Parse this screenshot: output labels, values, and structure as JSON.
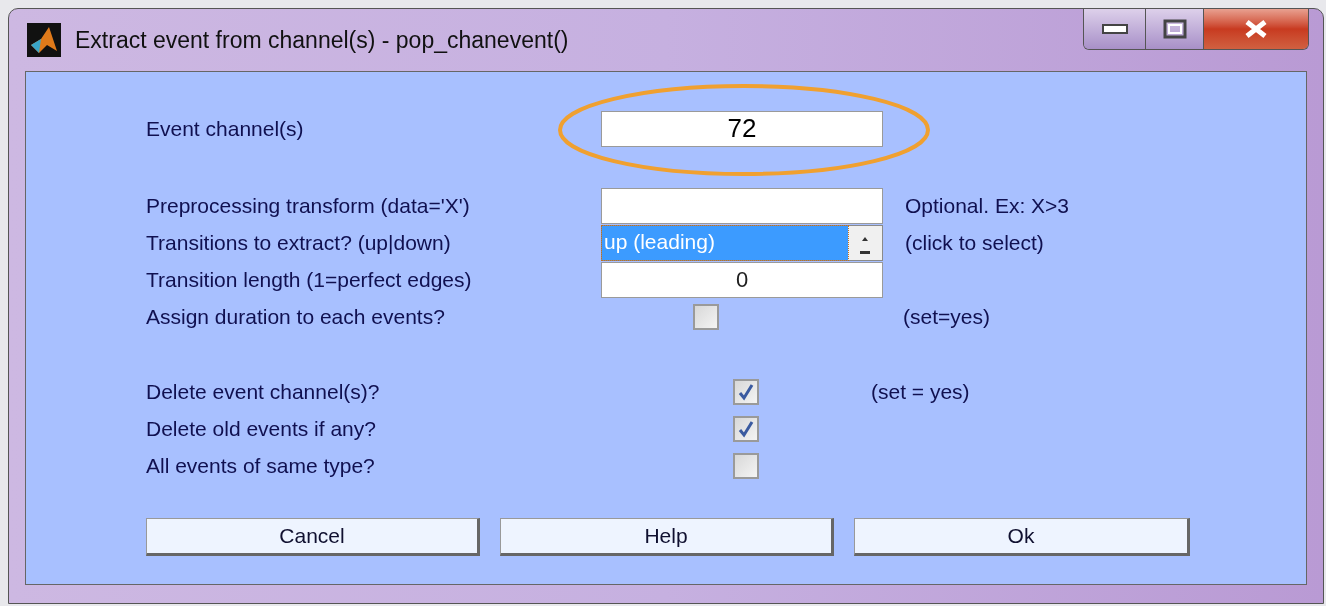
{
  "window": {
    "title": "Extract event from channel(s) - pop_chanevent()"
  },
  "groups": [
    [
      {
        "kind": "text",
        "label": "Event channel(s)",
        "value": "72",
        "highlighted": true
      }
    ],
    [
      {
        "kind": "text",
        "label": "Preprocessing transform (data='X')",
        "note": "Optional. Ex: X>3"
      },
      {
        "kind": "select",
        "label": "Transitions to extract? (up|down)",
        "value": "up (leading)",
        "note": "(click to select)"
      },
      {
        "kind": "text",
        "label": "Transition length (1=perfect edges)",
        "value": "0"
      },
      {
        "kind": "checkbox",
        "label": "Assign duration to each events?",
        "checked": false,
        "note": "(set=yes)"
      }
    ],
    [
      {
        "kind": "checkbox",
        "label": "Delete event channel(s)?",
        "checked": true,
        "note": "(set = yes)"
      },
      {
        "kind": "checkbox",
        "label": "Delete old events if any?",
        "checked": true
      },
      {
        "kind": "checkbox",
        "label": "All events of same type?",
        "checked": false
      }
    ]
  ],
  "buttons": [
    "Cancel",
    "Help",
    "Ok"
  ]
}
